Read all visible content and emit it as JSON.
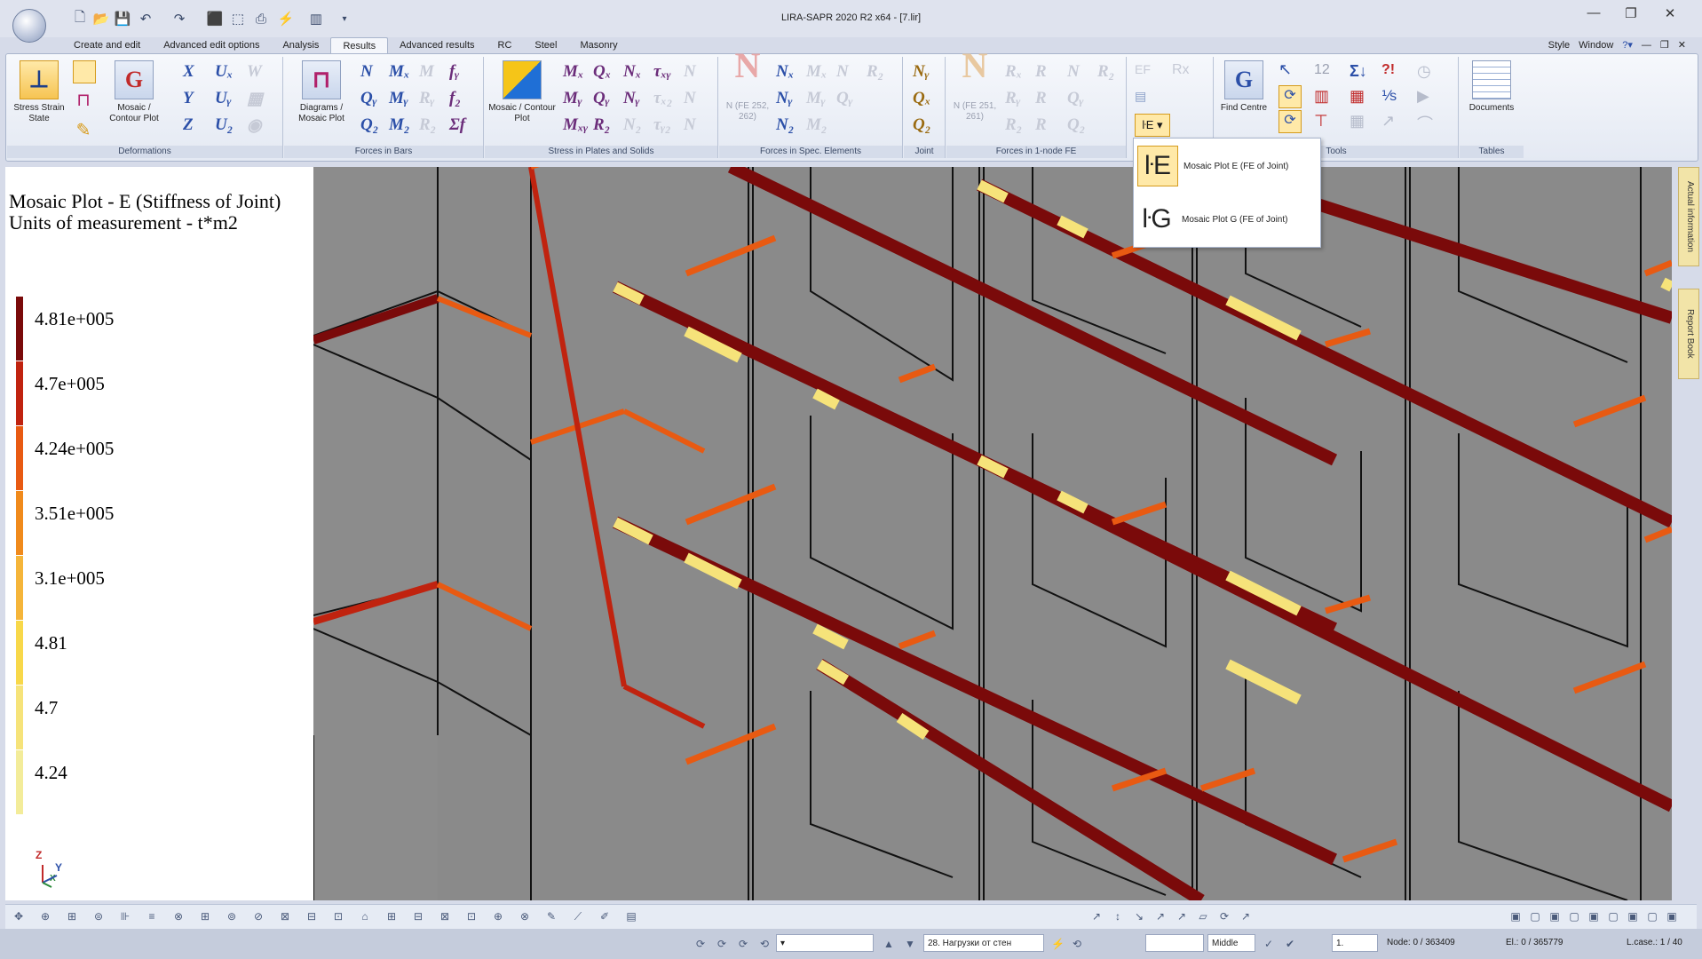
{
  "window": {
    "title": "LIRA-SAPR  2020 R2 x64 - [7.lir]",
    "minimize": "—",
    "restore": "❐",
    "close": "✕"
  },
  "tabs": [
    "Create and edit",
    "Advanced edit options",
    "Analysis",
    "Results",
    "Advanced results",
    "RC",
    "Steel",
    "Masonry"
  ],
  "active_tab": "Results",
  "tabs_right": {
    "style": "Style",
    "window": "Window"
  },
  "ribbon": {
    "groups": [
      "Deformations",
      "Forces in Bars",
      "Stress in Plates and Solids",
      "Forces in Spec. Elements",
      "Joint",
      "Forces in 1-node FE",
      "Tools",
      "Tables"
    ],
    "stress_strain_state": "Stress Strain State",
    "mosaic_contour_plot": "Mosaic / Contour Plot",
    "diagrams_mosaic_plot": "Diagrams / Mosaic Plot",
    "mosaic_contour_plot2": "Mosaic / Contour Plot",
    "n_fe_spec": "N (FE 252, 262)",
    "n_fe_1node": "N (FE 251, 261)",
    "find_centre": "Find Centre",
    "documents": "Documents"
  },
  "dropdown": {
    "item_e": "Mosaic Plot E (FE of Joint)",
    "item_g": "Mosaic Plot G (FE of Joint)"
  },
  "legend": {
    "title": "Mosaic Plot - E (Stiffness of Joint)",
    "units": "Units of measurement - t*m2",
    "values": [
      "4.81e+005",
      "4.7e+005",
      "4.24e+005",
      "3.51e+005",
      "3.1e+005",
      "4.81",
      "4.7",
      "4.24"
    ],
    "colors": [
      "#7a0a0a",
      "#c0230f",
      "#e85a12",
      "#f08a1c",
      "#f5b53a",
      "#f8d84a",
      "#f6e37a",
      "#f3ec9a"
    ]
  },
  "axes": {
    "z": "Z",
    "y": "Y",
    "x": "X"
  },
  "side_tabs": [
    "Actual information",
    "Report Book"
  ],
  "status": {
    "load_case": "28. Нагрузки от стен",
    "position": "Middle",
    "zoom": "1.",
    "node": "Node: 0 / 363409",
    "el": "El.: 0 / 365779",
    "lcase": "L.case.: 1 / 40"
  }
}
